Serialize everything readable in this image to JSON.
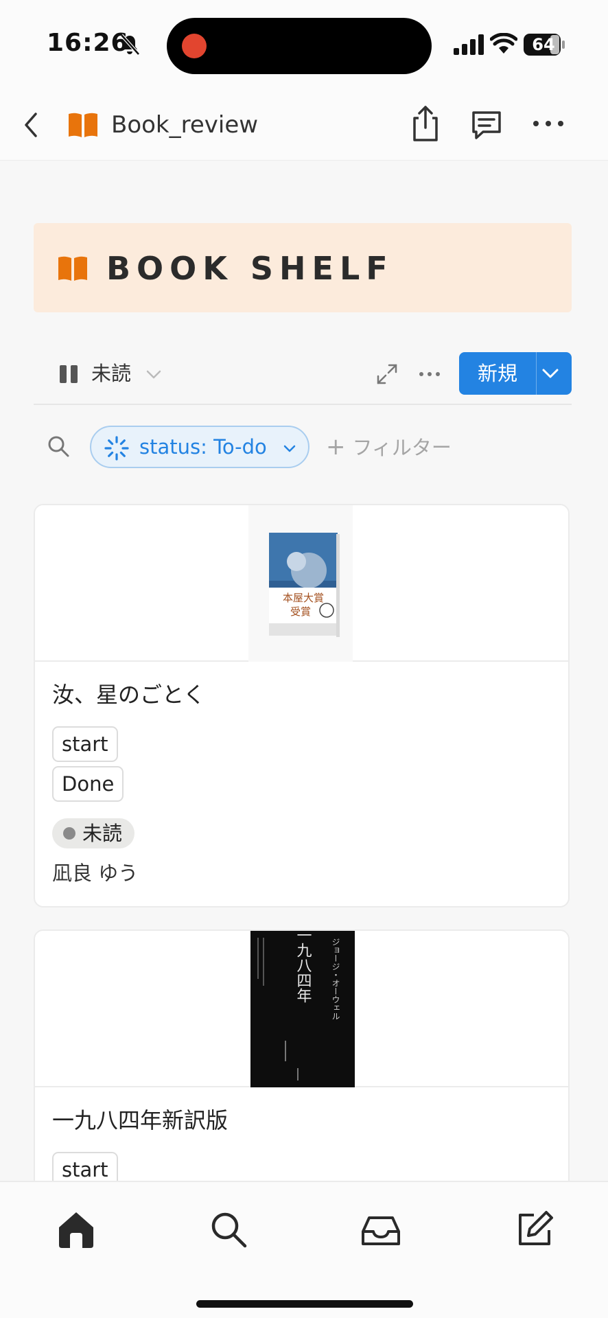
{
  "status_bar": {
    "time": "16:26",
    "battery_level": "64",
    "icons": [
      "bell-slash-icon",
      "signal-icon",
      "wifi-icon",
      "battery-icon"
    ],
    "recording_color": "#e2452f"
  },
  "nav": {
    "title": "Book_review",
    "icons": [
      "back-chevron-icon",
      "book-icon",
      "share-icon",
      "comment-icon",
      "more-icon"
    ]
  },
  "banner": {
    "title": "BOOK SHELF",
    "background": "#fcebdc",
    "icon_color": "#e8740c"
  },
  "toolbar": {
    "view_label": "未読",
    "new_button_label": "新規",
    "accent": "#2383e2"
  },
  "filters": {
    "status_chip_label": "status: To-do",
    "add_filter_label": "フィルター"
  },
  "cards": [
    {
      "title": "汝、星のごとく",
      "tags": [
        "start",
        "Done"
      ],
      "status": "未読",
      "author": "凪良 ゆう",
      "cover_text": [
        "本屋大賞",
        "受賞"
      ]
    },
    {
      "title": "一九八四年新訳版",
      "tags": [
        "start"
      ],
      "cover_text": [
        "一九八四年",
        "ジョージ・オーウェル"
      ]
    }
  ],
  "tab_bar": {
    "items": [
      "home-icon",
      "search-icon",
      "inbox-icon",
      "compose-icon"
    ]
  }
}
